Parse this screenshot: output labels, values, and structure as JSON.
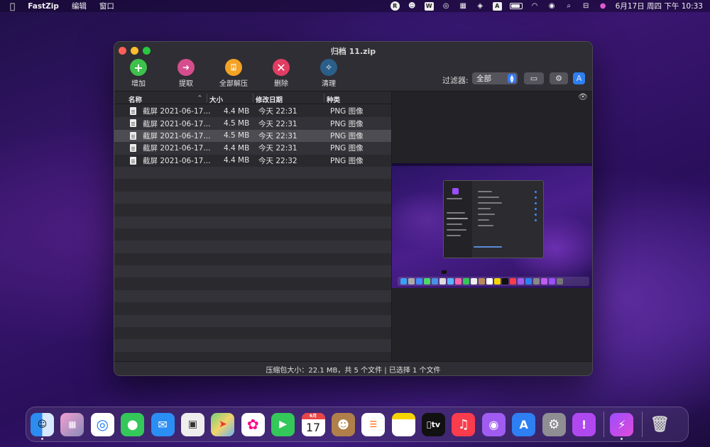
{
  "menubar": {
    "app_name": "FastZip",
    "menus": [
      "编辑",
      "窗口"
    ],
    "status_icons": [
      "R",
      "A"
    ],
    "datetime": "6月17日 周四 下午 10:33"
  },
  "window": {
    "title": "归档 11.zip",
    "toolbar": {
      "add": "增加",
      "extract": "提取",
      "extract_all": "全部解压",
      "delete": "删除",
      "clean": "清理"
    },
    "filter": {
      "label": "过滤器:",
      "value": "全部"
    },
    "columns": {
      "name": "名称",
      "size": "大小",
      "modified": "修改日期",
      "kind": "种类"
    },
    "files": [
      {
        "name": "截屏 2021-06-17...",
        "size": "4.4 MB",
        "modified": "今天 22:31",
        "kind": "PNG 图像"
      },
      {
        "name": "截屏 2021-06-17...",
        "size": "4.5 MB",
        "modified": "今天 22:31",
        "kind": "PNG 图像"
      },
      {
        "name": "截屏 2021-06-17...",
        "size": "4.5 MB",
        "modified": "今天 22:31",
        "kind": "PNG 图像"
      },
      {
        "name": "截屏 2021-06-17...",
        "size": "4.4 MB",
        "modified": "今天 22:31",
        "kind": "PNG 图像"
      },
      {
        "name": "截屏 2021-06-17...",
        "size": "4.4 MB",
        "modified": "今天 22:32",
        "kind": "PNG 图像"
      }
    ],
    "selected_index": 2,
    "status": "压缩包大小：22.1 MB，共 5 个文件 | 已选择 1 个文件"
  },
  "dock": {
    "calendar_month": "6月",
    "calendar_day": "17",
    "tv_label": "tv"
  },
  "colors": {
    "accent": "#2d7ff2",
    "window_bg": "#27262b",
    "selection": "#4d4c52"
  }
}
